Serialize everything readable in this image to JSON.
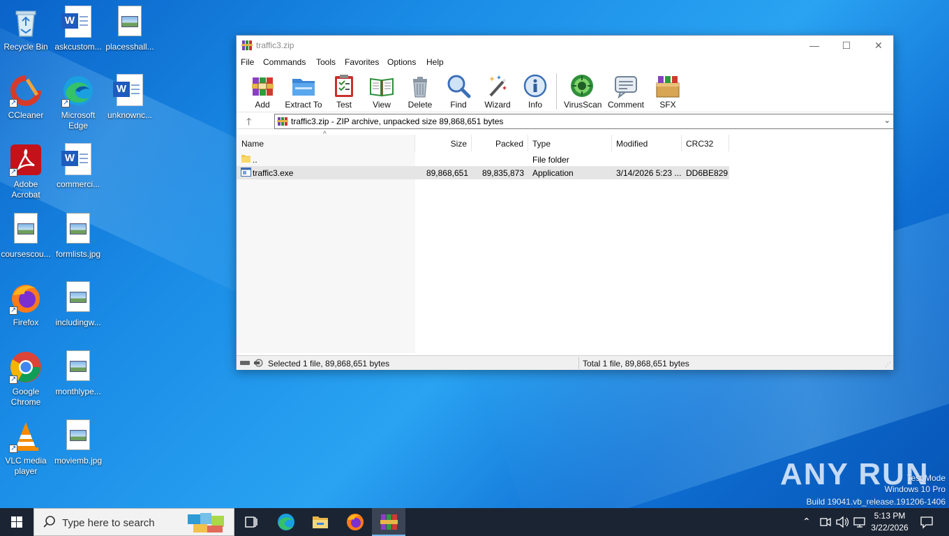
{
  "desktop": {
    "icons": [
      {
        "label": "Recycle Bin"
      },
      {
        "label": "askcustom..."
      },
      {
        "label": "placesshall..."
      },
      {
        "label": "CCleaner"
      },
      {
        "label": "Microsoft Edge"
      },
      {
        "label": "unknownc..."
      },
      {
        "label": "Adobe Acrobat"
      },
      {
        "label": "commerci..."
      },
      {
        "label": "coursescou..."
      },
      {
        "label": "formlists.jpg"
      },
      {
        "label": "Firefox"
      },
      {
        "label": "includingw..."
      },
      {
        "label": "Google Chrome"
      },
      {
        "label": "monthlype..."
      },
      {
        "label": "VLC media player"
      },
      {
        "label": "moviemb.jpg"
      }
    ]
  },
  "window": {
    "title": "traffic3.zip",
    "controls": {
      "minimize": "—",
      "maximize": "☐",
      "close": "✕"
    },
    "menu": [
      "File",
      "Commands",
      "Tools",
      "Favorites",
      "Options",
      "Help"
    ],
    "toolbar": [
      "Add",
      "Extract To",
      "Test",
      "View",
      "Delete",
      "Find",
      "Wizard",
      "Info",
      "VirusScan",
      "Comment",
      "SFX"
    ],
    "address": "traffic3.zip - ZIP archive, unpacked size 89,868,651 bytes",
    "columns": [
      "Name",
      "Size",
      "Packed",
      "Type",
      "Modified",
      "CRC32"
    ],
    "rows": [
      {
        "name": "..",
        "size": "",
        "packed": "",
        "type": "File folder",
        "modified": "",
        "crc": ""
      },
      {
        "name": "traffic3.exe",
        "size": "89,868,651",
        "packed": "89,835,873",
        "type": "Application",
        "modified": "3/14/2026 5:23 ...",
        "crc": "DD6BE829"
      }
    ],
    "status_left": "Selected 1 file, 89,868,651 bytes",
    "status_right": "Total 1 file, 89,868,651 bytes"
  },
  "taskbar": {
    "search_placeholder": "Type here to search",
    "time": "5:13 PM",
    "date": "3/22/2026"
  },
  "watermark": {
    "brand": "ANY RUN",
    "line1": "Test Mode",
    "line2": "Windows 10 Pro",
    "line3": "Build 19041.vb_release.191206-1406"
  },
  "colors": {
    "taskbar": "#1b2433",
    "selection": "#e5e5e5",
    "desktop_accent": "#1a8ce6"
  }
}
